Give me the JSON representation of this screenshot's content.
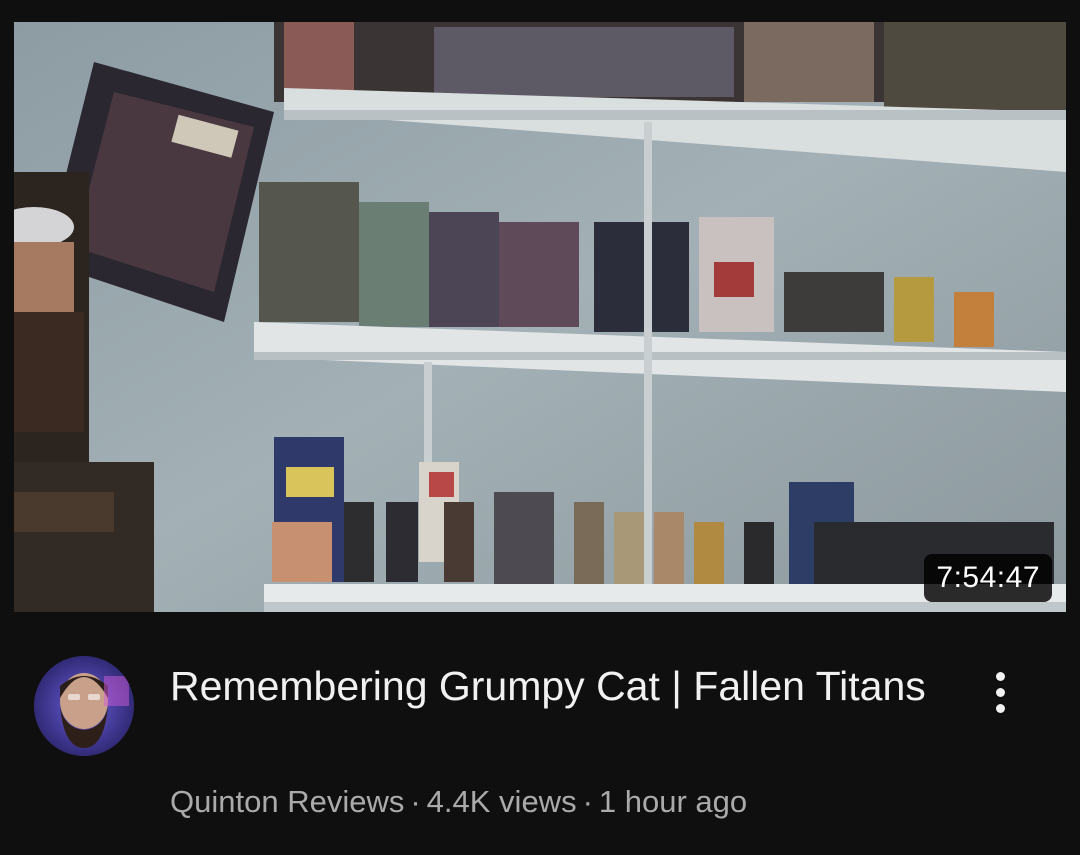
{
  "video": {
    "duration": "7:54:47",
    "title": "Remembering Grumpy Cat | Fallen Titans",
    "channel": "Quinton Reviews",
    "views": "4.4K views",
    "age": "1 hour ago",
    "separator": "·"
  },
  "icons": {
    "more": "more-vert-icon"
  },
  "colors": {
    "background": "#0f0f0f",
    "title_text": "#f1f1f1",
    "meta_text": "#aaaaaa",
    "duration_badge_bg": "#000000"
  }
}
